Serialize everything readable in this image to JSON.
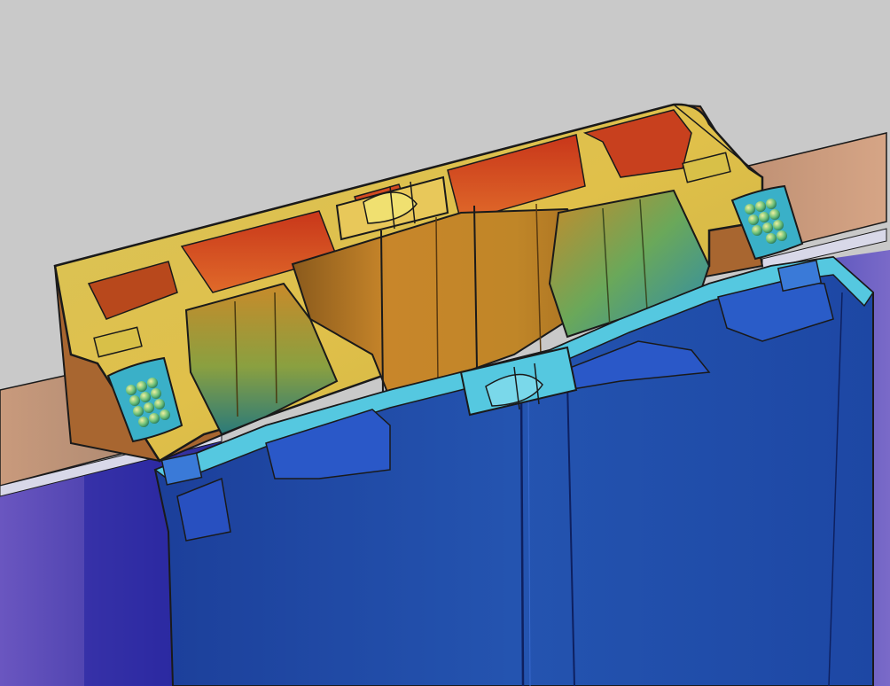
{
  "scene": {
    "subject": "thermal-simulation-window-profile-cross-section",
    "colors": {
      "background": "#c9c9c9",
      "hot": "#d8401e",
      "warm": "#e0a331",
      "mid": "#d9d35c",
      "cool_green": "#4bb08a",
      "cool_cyan": "#4cc6d8",
      "cold": "#1e4bb8",
      "coldest": "#14308a",
      "glass_warm": "#d6a27e",
      "glass_cold": "#5a48b8",
      "edge": "#1a1a1a"
    },
    "icons": {
      "thermal-break": "polyamide-strip",
      "spacer": "desiccant-spacer"
    }
  }
}
